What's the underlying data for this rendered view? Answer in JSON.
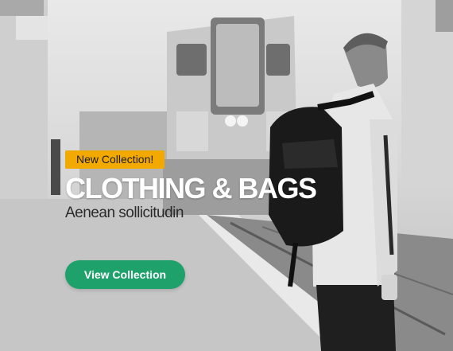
{
  "hero": {
    "badge_label": "New Collection!",
    "headline": "CLOTHING & BAGS",
    "subheadline": "Aenean sollicitudin",
    "cta_label": "View Collection"
  },
  "colors": {
    "badge_bg": "#f2a900",
    "cta_bg": "#1ea16b",
    "headline_text": "#ffffff"
  },
  "background": {
    "subject": "black-and-white train platform, man with black backpack",
    "icon": "photo-background"
  }
}
